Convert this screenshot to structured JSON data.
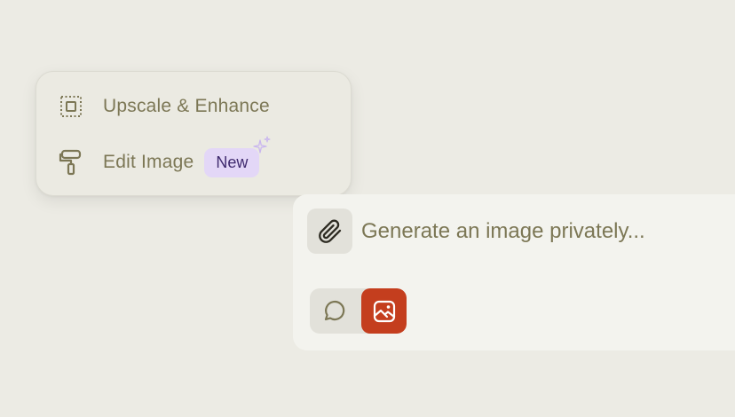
{
  "menu": {
    "items": [
      {
        "label": "Upscale & Enhance",
        "icon": "upscale-icon"
      },
      {
        "label": "Edit Image",
        "icon": "paint-roller-icon",
        "badge": "New"
      }
    ]
  },
  "prompt": {
    "placeholder": "Generate an image privately...",
    "value": ""
  },
  "modes": {
    "items": [
      {
        "name": "chat",
        "icon": "chat-bubble-icon",
        "active": false
      },
      {
        "name": "image",
        "icon": "image-icon",
        "active": true
      }
    ]
  },
  "colors": {
    "background": "#ecebe4",
    "panel": "#f3f3ee",
    "text": "#7c7755",
    "accent": "#c43e1e",
    "badge_bg": "#e3d7f7",
    "badge_text": "#3f2a6e",
    "sparkle": "#c9b6ef"
  }
}
